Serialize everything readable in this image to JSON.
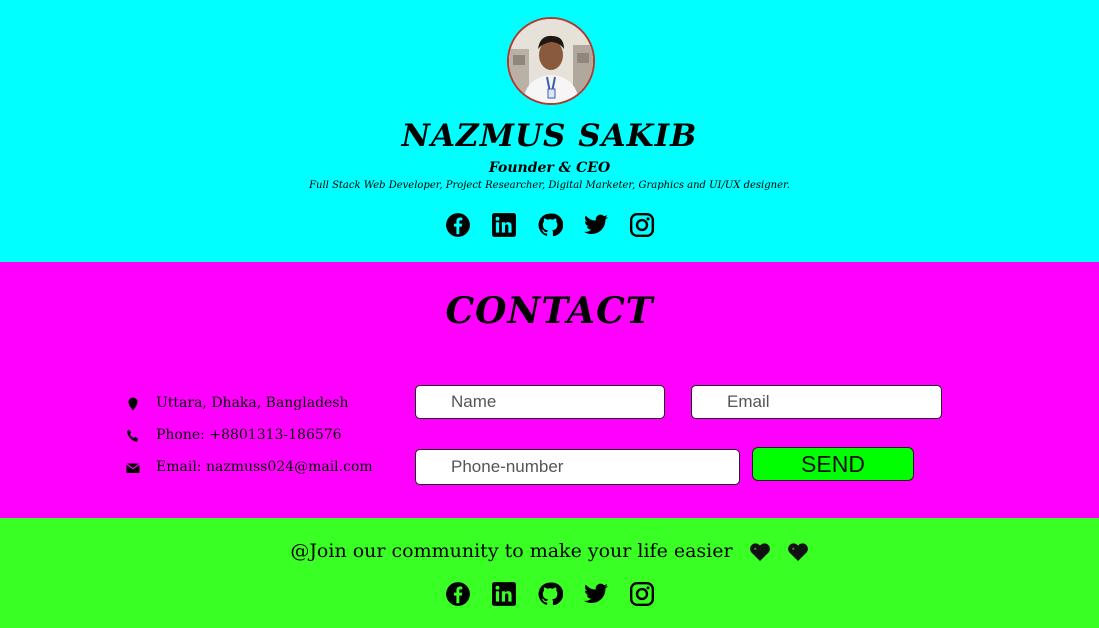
{
  "profile": {
    "name": "NAZMUS SAKIB",
    "role": "Founder & CEO",
    "description": "Full Stack Web Developer, Project Researcher, Digital Marketer, Graphics and UI/UX designer."
  },
  "social_icons": [
    "facebook-icon",
    "linkedin-icon",
    "github-icon",
    "twitter-icon",
    "instagram-icon"
  ],
  "contact": {
    "title": "CONTACT",
    "address": "Uttara, Dhaka, Bangladesh",
    "phone": "Phone: +8801313-186576",
    "email": "Email: nazmuss024@mail.com",
    "form": {
      "name_placeholder": "Name",
      "email_placeholder": "Email",
      "phone_placeholder": "Phone-number",
      "send_label": "SEND"
    }
  },
  "footer": {
    "join_text": "@Join our community to make your life easier"
  },
  "colors": {
    "hero_bg": "#00ffff",
    "contact_bg": "#ff00ff",
    "footer_bg": "#39ff24",
    "send_bg": "#00ff00"
  }
}
